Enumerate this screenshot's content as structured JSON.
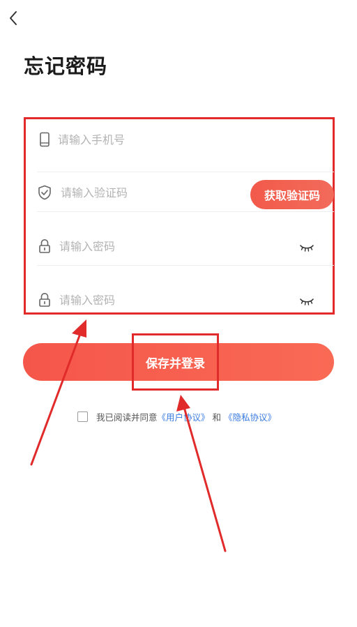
{
  "nav": {
    "back_icon": "chevron-left-icon"
  },
  "page_title": "忘记密码",
  "form": {
    "phone": {
      "placeholder": "请输入手机号",
      "icon": "phone-icon"
    },
    "code": {
      "placeholder": "请输入验证码",
      "icon": "shield-check-icon",
      "button_label": "获取验证码"
    },
    "password": {
      "placeholder": "请输入密码",
      "icon": "lock-icon",
      "eye_icon": "eye-closed-icon"
    },
    "confirm_password": {
      "placeholder": "请输入密码",
      "icon": "lock-icon",
      "eye_icon": "eye-closed-icon"
    }
  },
  "submit": {
    "label": "保存并登录"
  },
  "agreement": {
    "prefix": "我已阅读并同意",
    "user_agreement": "《用户协议》",
    "connector": "和",
    "privacy_policy": "《隐私协议》"
  },
  "colors": {
    "accent": "#f5564a",
    "highlight_border": "#e12a2a",
    "link": "#3a7be0",
    "placeholder": "#b3b3b3"
  }
}
